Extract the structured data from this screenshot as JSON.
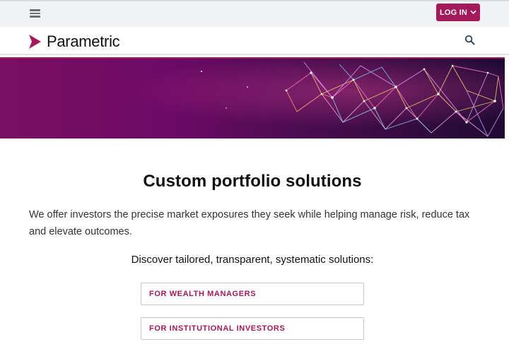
{
  "header": {
    "login_label": "LOG IN",
    "accent_color": "#a3195b"
  },
  "brand": {
    "name": "Parametric"
  },
  "main": {
    "heading": "Custom portfolio solutions",
    "intro": "We offer investors the precise market exposures they seek while helping manage risk, reduce tax and elevate outcomes.",
    "discover": "Discover tailored, transparent, systematic solutions:",
    "buttons": [
      {
        "label": "FOR WEALTH MANAGERS"
      },
      {
        "label": "FOR INSTITUTIONAL INVESTORS"
      }
    ]
  },
  "icons": {
    "menu": "hamburger-icon",
    "search": "search-icon",
    "chevron": "chevron-down-icon",
    "logo": "play-triangle-logo"
  }
}
